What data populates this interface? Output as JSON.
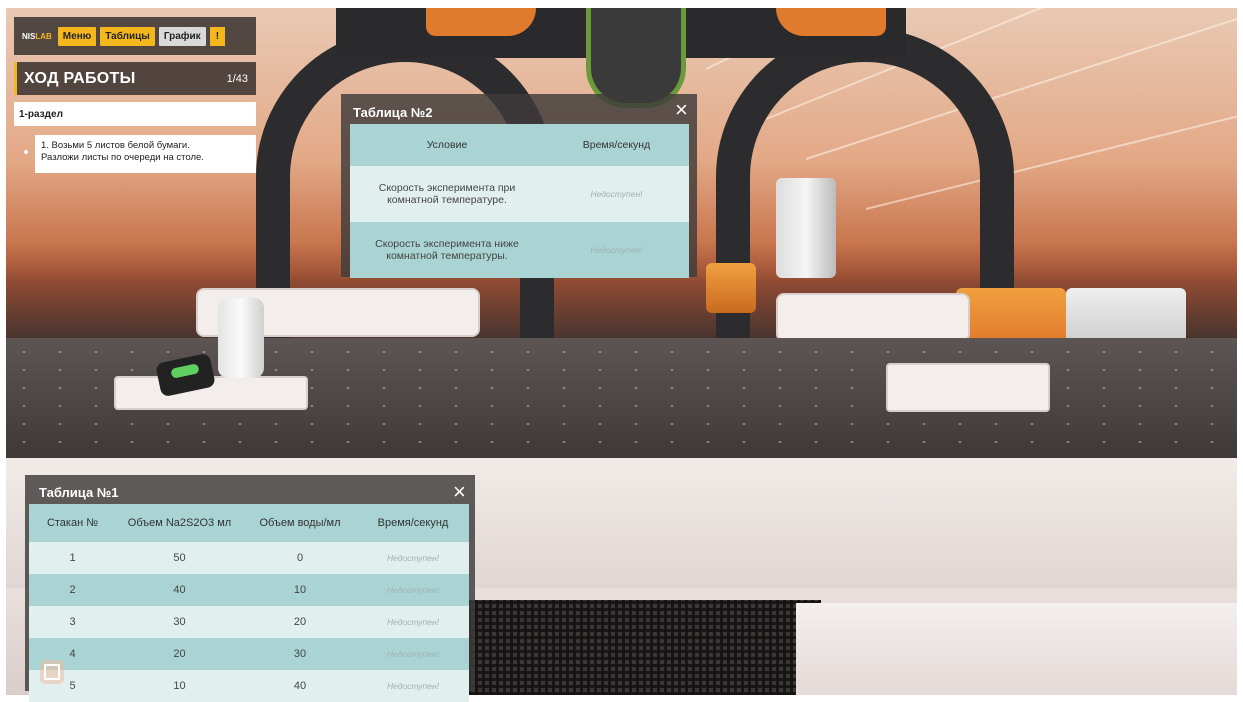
{
  "hud": {
    "logo_a": "NIS",
    "logo_b": "LAB",
    "menu": "Меню",
    "tables": "Таблицы",
    "graph": "График",
    "alert": "!",
    "progress_title": "ХОД РАБОТЫ",
    "progress_count": "1/43",
    "section": "1-раздел",
    "step_line1": "1. Возьми 5 листов белой бумаги.",
    "step_line2": "Разложи листы по очереди на столе."
  },
  "colors": {
    "accent": "#f5b81c",
    "table_header": "#a9d4d3",
    "table_row_light": "#e2efef"
  },
  "table2": {
    "title": "Таблица №2",
    "close_icon": "close-icon",
    "headers": [
      "Условие",
      "Время/секунд"
    ],
    "rows": [
      {
        "condition_l1": "Скорость эксперимента при",
        "condition_l2": "комнатной температуре.",
        "time": "Недоступен!"
      },
      {
        "condition_l1": "Скорость эксперимента ниже",
        "condition_l2": "комнатной температуры.",
        "time": "Недоступен!"
      }
    ]
  },
  "table1": {
    "title": "Таблица №1",
    "close_icon": "close-icon",
    "headers": [
      "Стакан №",
      "Объем Na2S2O3 мл",
      "Объем воды/мл",
      "Время/секунд"
    ],
    "rows": [
      [
        "1",
        "50",
        "0",
        "Недоступен!"
      ],
      [
        "2",
        "40",
        "10",
        "Недоступен!"
      ],
      [
        "3",
        "30",
        "20",
        "Недоступен!"
      ],
      [
        "4",
        "20",
        "30",
        "Недоступен!"
      ],
      [
        "5",
        "10",
        "40",
        "Недоступен!"
      ]
    ]
  },
  "fullscreen_icon": "fullscreen-icon"
}
